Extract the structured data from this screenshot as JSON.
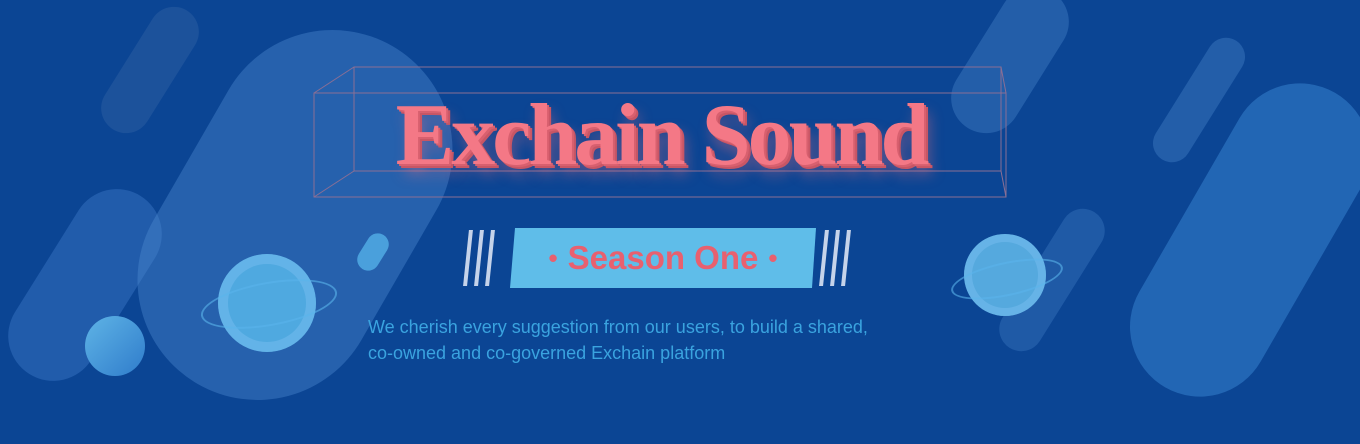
{
  "banner": {
    "title": "Exchain Sound",
    "subtitle": "Season One",
    "bullet": "•",
    "description_line1": "We cherish every suggestion from our users, to build a shared,",
    "description_line2": "co-owned and co-governed Exchain platform"
  },
  "colors": {
    "background": "#0b4594",
    "title": "#f47886",
    "season_bg": "#5fbde9",
    "season_text": "#e8606f",
    "description": "#3aa3df"
  }
}
